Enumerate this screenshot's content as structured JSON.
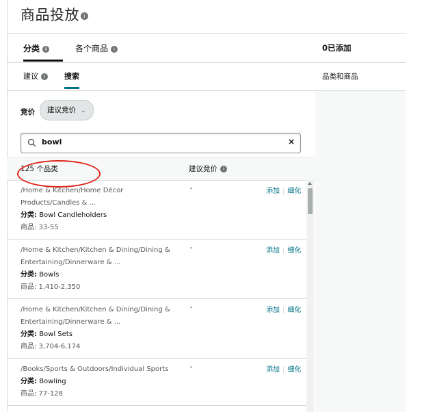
{
  "page": {
    "title": "商品投放"
  },
  "tabs": [
    {
      "label": "分类"
    },
    {
      "label": "各个商品"
    }
  ],
  "subtabs": [
    {
      "label": "建议"
    },
    {
      "label": "搜索"
    }
  ],
  "bid": {
    "label": "竞价",
    "selected": "建议竞价"
  },
  "search": {
    "value": "bowl",
    "clear_label": "×"
  },
  "list": {
    "count_label": "125 个品类",
    "suggested_bid_header": "建议竞价",
    "action_add": "添加",
    "action_refine": "细化",
    "separator": "|",
    "rows": [
      {
        "path1": "/Home & Kitchen/Home Décor",
        "path2": "Products/Candles & ...",
        "cat_prefix": "分类:",
        "cat_name": "Bowl Candleholders",
        "count": "商品: 33-55",
        "bid": "-"
      },
      {
        "path1": "/Home & Kitchen/Kitchen & Dining/Dining &",
        "path2": "Entertaining/Dinnerware & ...",
        "cat_prefix": "分类:",
        "cat_name": "Bowls",
        "count": "商品: 1,410-2,350",
        "bid": "-"
      },
      {
        "path1": "/Home & Kitchen/Kitchen & Dining/Dining &",
        "path2": "Entertaining/Dinnerware & ...",
        "cat_prefix": "分类:",
        "cat_name": "Bowl Sets",
        "count": "商品: 3,704-6,174",
        "bid": "-"
      },
      {
        "path1": "/Books/Sports & Outdoors/Individual Sports",
        "path2": "",
        "cat_prefix": "分类:",
        "cat_name": "Bowling",
        "count": "商品: 77-128",
        "bid": "-"
      }
    ]
  },
  "right_panel": {
    "header": "0已添加",
    "subheader": "品类和商品"
  },
  "colors": {
    "link": "#007185",
    "annotation": "#e0251b",
    "border": "#d5d9d9"
  }
}
